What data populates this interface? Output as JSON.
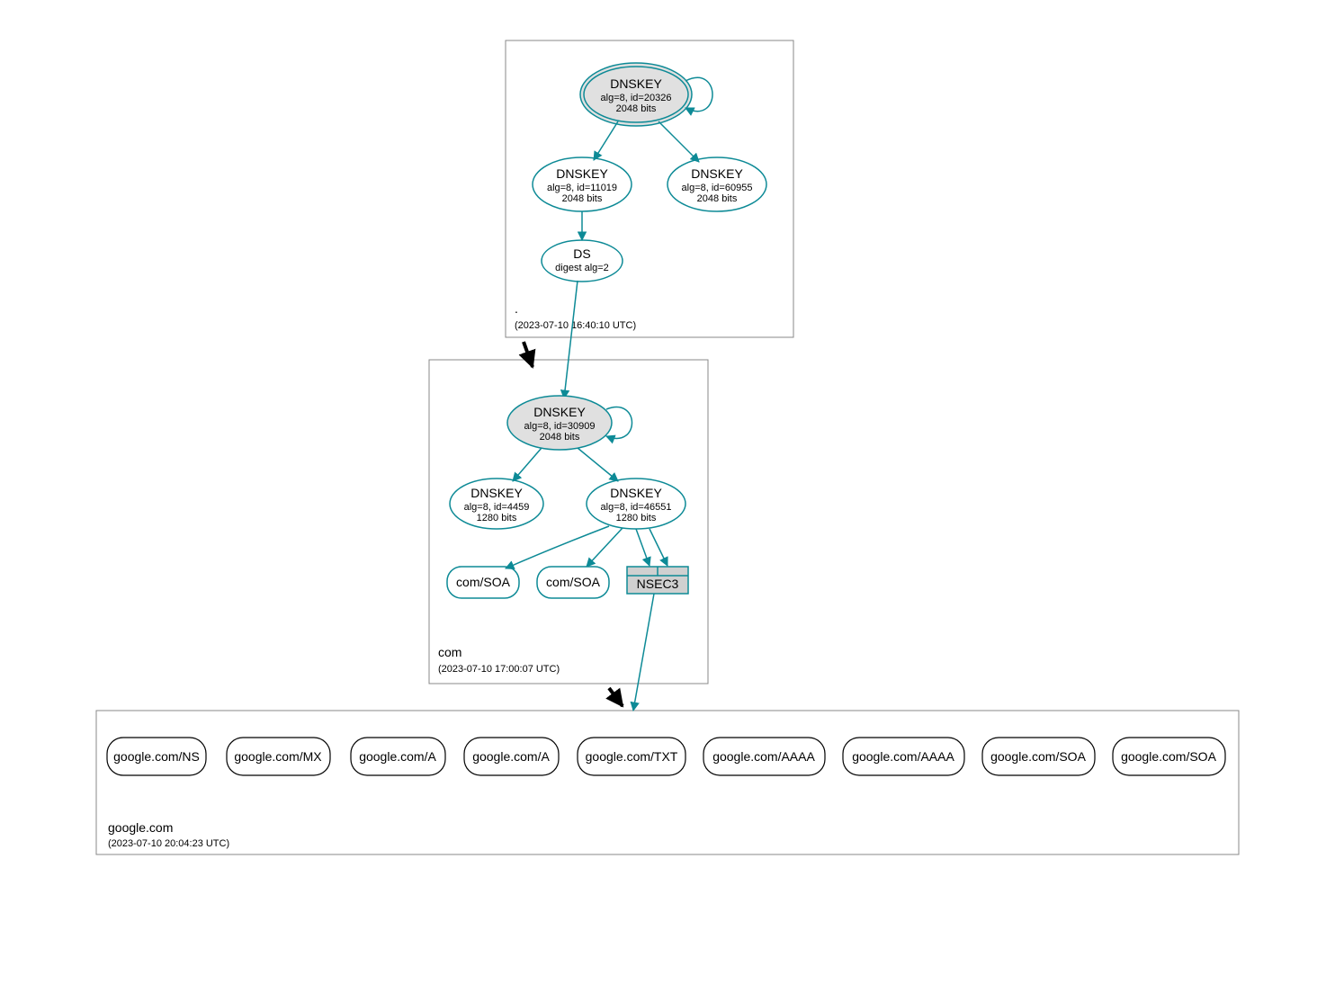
{
  "zones": {
    "root": {
      "label": ".",
      "timestamp": "(2023-07-10 16:40:10 UTC)"
    },
    "com": {
      "label": "com",
      "timestamp": "(2023-07-10 17:00:07 UTC)"
    },
    "google": {
      "label": "google.com",
      "timestamp": "(2023-07-10 20:04:23 UTC)"
    }
  },
  "nodes": {
    "root_ksk": {
      "title": "DNSKEY",
      "line2": "alg=8, id=20326",
      "line3": "2048 bits"
    },
    "root_zsk1": {
      "title": "DNSKEY",
      "line2": "alg=8, id=11019",
      "line3": "2048 bits"
    },
    "root_zsk2": {
      "title": "DNSKEY",
      "line2": "alg=8, id=60955",
      "line3": "2048 bits"
    },
    "root_ds": {
      "title": "DS",
      "line2": "digest alg=2"
    },
    "com_ksk": {
      "title": "DNSKEY",
      "line2": "alg=8, id=30909",
      "line3": "2048 bits"
    },
    "com_zsk1": {
      "title": "DNSKEY",
      "line2": "alg=8, id=4459",
      "line3": "1280 bits"
    },
    "com_zsk2": {
      "title": "DNSKEY",
      "line2": "alg=8, id=46551",
      "line3": "1280 bits"
    },
    "com_soa1": {
      "title": "com/SOA"
    },
    "com_soa2": {
      "title": "com/SOA"
    },
    "com_nsec3": {
      "title": "NSEC3"
    },
    "g_ns": {
      "title": "google.com/NS"
    },
    "g_mx": {
      "title": "google.com/MX"
    },
    "g_a1": {
      "title": "google.com/A"
    },
    "g_a2": {
      "title": "google.com/A"
    },
    "g_txt": {
      "title": "google.com/TXT"
    },
    "g_aaaa1": {
      "title": "google.com/AAAA"
    },
    "g_aaaa2": {
      "title": "google.com/AAAA"
    },
    "g_soa1": {
      "title": "google.com/SOA"
    },
    "g_soa2": {
      "title": "google.com/SOA"
    }
  }
}
